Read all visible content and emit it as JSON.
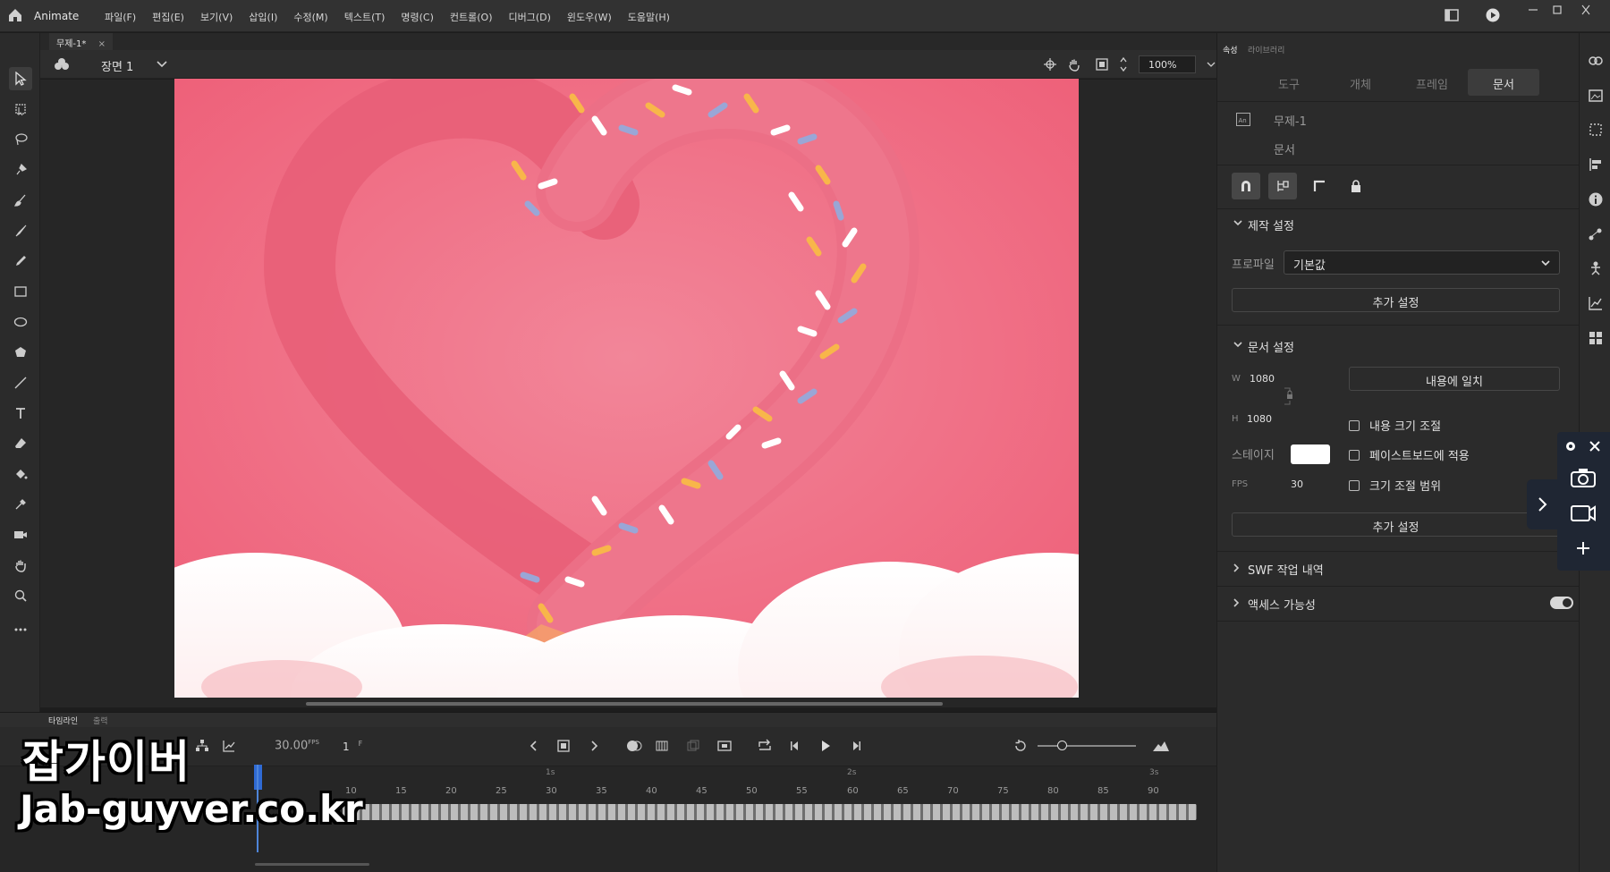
{
  "app": {
    "name": "Animate",
    "menus": [
      "파일(F)",
      "편집(E)",
      "보기(V)",
      "삽입(I)",
      "수정(M)",
      "텍스트(T)",
      "명령(C)",
      "컨트롤(O)",
      "디버그(D)",
      "윈도우(W)",
      "도움말(H)"
    ]
  },
  "document": {
    "tab_title": "무제-1*",
    "close": "×"
  },
  "stage": {
    "scene": "장면 1",
    "zoom": "100%"
  },
  "timeline": {
    "tabs": [
      "타임라인",
      "출력"
    ],
    "fps": "30.00",
    "fps_unit": "FPS",
    "frame": "1",
    "frame_unit": "F",
    "seconds": [
      "1s",
      "2s",
      "3s"
    ],
    "frame_ticks": [
      "10",
      "15",
      "20",
      "25",
      "30",
      "35",
      "40",
      "45",
      "50",
      "55",
      "60",
      "65",
      "70",
      "75",
      "80",
      "85",
      "90"
    ]
  },
  "panel": {
    "tabs": [
      "속성",
      "라이브러리"
    ],
    "segments": [
      "도구",
      "개체",
      "프레임",
      "문서"
    ],
    "doc_name": "무제-1",
    "doc_type": "문서",
    "publish": {
      "title": "제작 설정",
      "profile_label": "프로파일",
      "profile_value": "기본값",
      "more_settings": "추가 설정"
    },
    "doc_settings": {
      "title": "문서 설정",
      "w_label": "W",
      "w_value": "1080",
      "h_label": "H",
      "h_value": "1080",
      "fit_button": "내용에 일치",
      "scale_content": "내용 크기 조절",
      "apply_pasteboard": "페이스트보드에 적용",
      "scale_spans": "크기 조절 범위",
      "stage_label": "스테이지",
      "stage_color": "#ffffff",
      "fps_label": "FPS",
      "fps_value": "30",
      "more_settings": "추가 설정"
    },
    "swf_history": "SWF 작업 내역",
    "accessibility": "액세스 가능성"
  },
  "watermark": {
    "line1": "잡가이버",
    "line2": "Jab-guyver.co.kr"
  },
  "colors": {
    "accent": "#2f6ad4",
    "canvas_bg": "#f06c83",
    "cloud": "#ffffff"
  }
}
